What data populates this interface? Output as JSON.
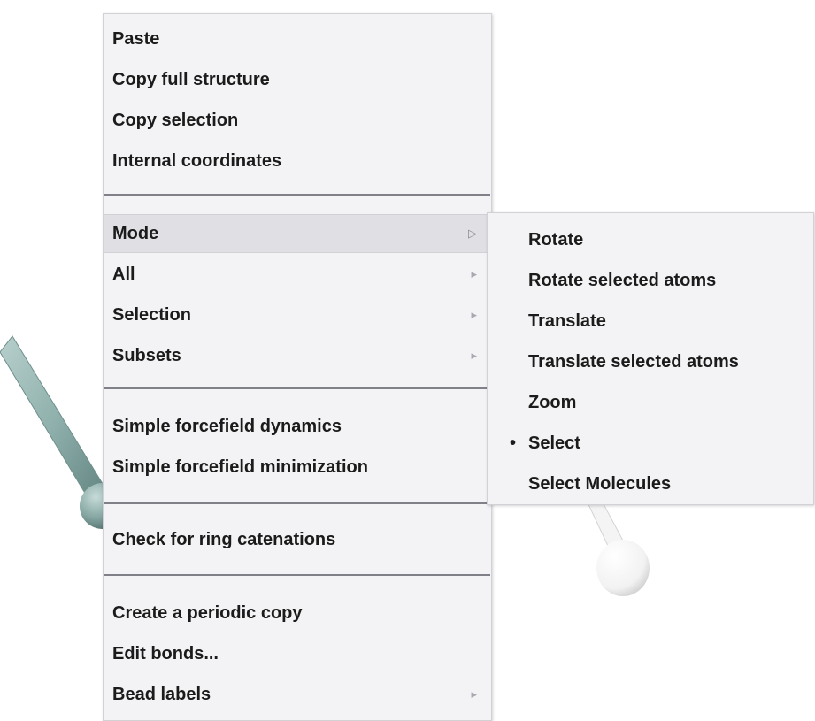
{
  "background_scene": {
    "bond_color": "#8fb0ac",
    "atom_color": "#ffffff"
  },
  "context_menu": {
    "items": [
      {
        "label": "Paste",
        "has_submenu": false
      },
      {
        "label": "Copy full structure",
        "has_submenu": false
      },
      {
        "label": "Copy selection",
        "has_submenu": false
      },
      {
        "label": "Internal coordinates",
        "has_submenu": false
      },
      {
        "label": "Mode",
        "has_submenu": true,
        "active": true
      },
      {
        "label": "All",
        "has_submenu": true
      },
      {
        "label": "Selection",
        "has_submenu": true
      },
      {
        "label": "Subsets",
        "has_submenu": true
      },
      {
        "label": "Simple forcefield dynamics",
        "has_submenu": false
      },
      {
        "label": "Simple forcefield minimization",
        "has_submenu": false
      },
      {
        "label": "Check for ring catenations",
        "has_submenu": false
      },
      {
        "label": "Create a periodic copy",
        "has_submenu": false
      },
      {
        "label": "Edit bonds...",
        "has_submenu": false
      },
      {
        "label": "Bead labels",
        "has_submenu": true
      }
    ],
    "submenu_arrow_icon": "triangle-right-icon"
  },
  "mode_submenu": {
    "items": [
      {
        "label": "Rotate",
        "checked": false
      },
      {
        "label": "Rotate selected atoms",
        "checked": false
      },
      {
        "label": "Translate",
        "checked": false
      },
      {
        "label": "Translate selected atoms",
        "checked": false
      },
      {
        "label": "Zoom",
        "checked": false
      },
      {
        "label": "Select",
        "checked": true
      },
      {
        "label": "Select Molecules",
        "checked": false
      }
    ],
    "bullet_glyph": "•"
  }
}
